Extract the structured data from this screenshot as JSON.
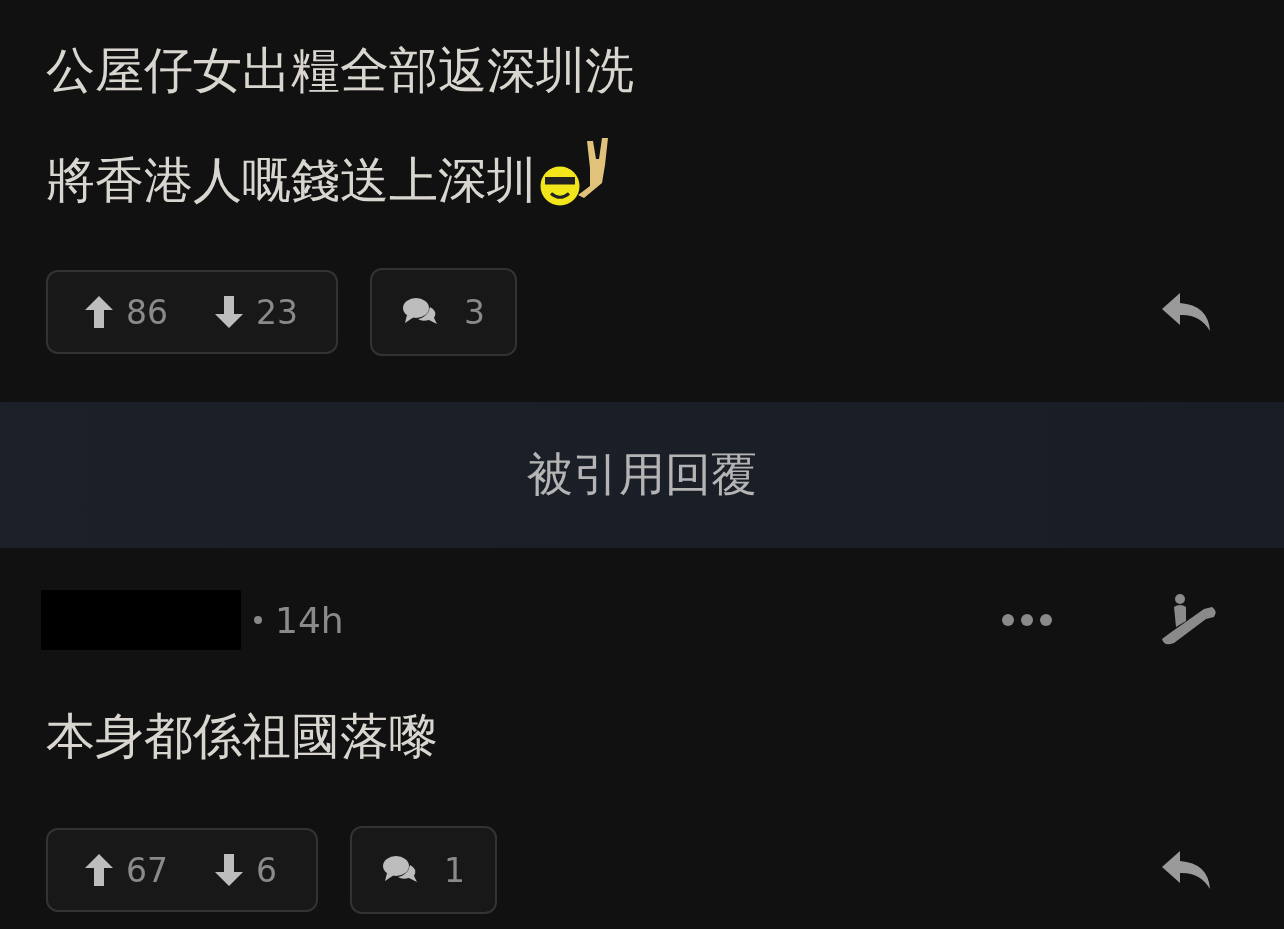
{
  "posts": [
    {
      "lines": [
        {
          "text": "公屋仔女出糧全部返深圳洗",
          "emoji": false
        },
        {
          "text": "將香港人嘅錢送上深圳",
          "emoji": true
        }
      ],
      "upvotes": "86",
      "downvotes": "23",
      "comments": "3"
    }
  ],
  "quoted_banner": "被引用回覆",
  "replies": [
    {
      "time": "14h",
      "lines": [
        {
          "text": "本身都係祖國落嚟",
          "emoji": false
        }
      ],
      "upvotes": "67",
      "downvotes": "6",
      "comments": "1"
    }
  ]
}
